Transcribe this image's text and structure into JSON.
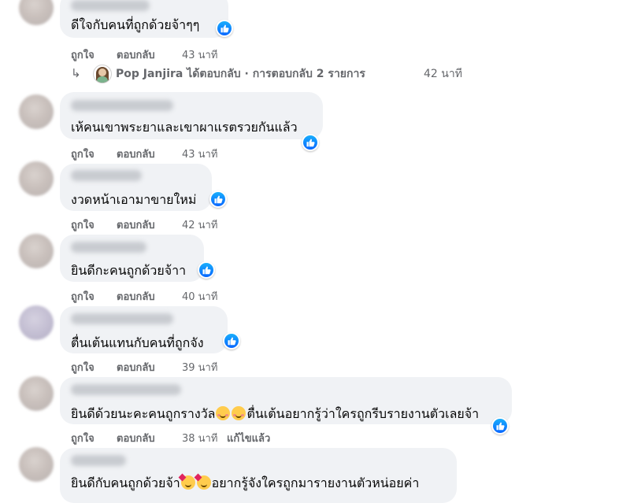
{
  "actions": {
    "like": "ถูกใจ",
    "reply": "ตอบกลับ",
    "edited": "แก้ไขแล้ว"
  },
  "reply_summary": {
    "arrow_icon": "reply-arrow-icon",
    "user": "Pop Janjira",
    "text": "Pop Janjira ได้ตอบกลับ · การตอบกลับ 2 รายการ",
    "time": "42 นาที"
  },
  "comments": [
    {
      "text": "ดีใจกับคนที่ถูกด้วยจ้าๆๆ",
      "time": "43 นาที",
      "reaction": "like"
    },
    {
      "text": "เห้คนเขาพระยาและเขาผาแรตรวยกันแล้ว",
      "time": "43 นาที",
      "reaction": "like"
    },
    {
      "text": "งวดหน้าเอามาขายใหม่",
      "time": "42 นาที",
      "reaction": "like"
    },
    {
      "text": "ยินดีกะคนถูกด้วยจ้าา",
      "time": "40 นาที",
      "reaction": "like"
    },
    {
      "text": "ตื่นเต้นแทนกับคนที่ถูกจัง",
      "time": "39 นาที",
      "reaction": "like"
    },
    {
      "text_before": "ยินดีด้วยนะคะคนถูกรางวัล",
      "text_after": "ตื่นเต้นอยากรู้ว่าใครถูกรีบรายงานตัวเลยจ้า",
      "emoji": "smiling-blush-emoji",
      "time": "38 นาที",
      "reaction": "like"
    },
    {
      "text_before": "ยินดีกับคนถูกด้วยจ้า",
      "text_after": "อยากรู้จังใครถูกมารายงานตัวหน่อยค่า",
      "emoji": "smiling-face-with-hearts-emoji"
    }
  ],
  "colors": {
    "bubble": "#f0f2f5",
    "like_blue": "#0866ff",
    "meta_gray": "#65676b"
  }
}
